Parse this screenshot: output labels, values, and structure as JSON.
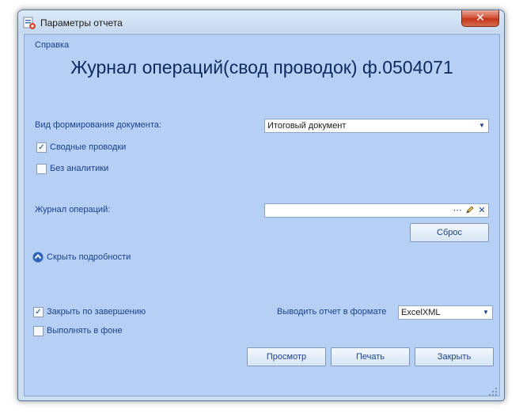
{
  "window": {
    "title": "Параметры отчета",
    "close_glyph": "✕",
    "icon": "report-app-icon"
  },
  "help_link": "Справка",
  "report_title": "Журнал операций(свод проводок) ф.0504071",
  "form": {
    "doc_type_label": "Вид формирования документа:",
    "doc_type_value": "Итоговый документ",
    "summary_entries_label": "Сводные проводки",
    "summary_entries_checked": true,
    "no_analytics_label": "Без аналитики",
    "no_analytics_checked": false,
    "journal_label": "Журнал операций:",
    "journal_value": "",
    "ellipsis_glyph": "⋯",
    "clear_glyph": "✕",
    "reset_button": "Сброс",
    "hide_details_link": "Скрыть подробности"
  },
  "footer": {
    "close_on_finish_label": "Закрыть по завершению",
    "close_on_finish_checked": true,
    "run_background_label": "Выполнять в фоне",
    "run_background_checked": false,
    "format_label": "Выводить отчет в формате",
    "format_value": "ExcelXML",
    "preview_button": "Просмотр",
    "print_button": "Печать",
    "close_button": "Закрыть"
  },
  "check_glyph": "✓",
  "dropdown_glyph": "▼",
  "colors": {
    "content_bg": "#b5d0f4",
    "text_blue": "#1d3f8c",
    "title_blue": "#0e2a5f"
  }
}
